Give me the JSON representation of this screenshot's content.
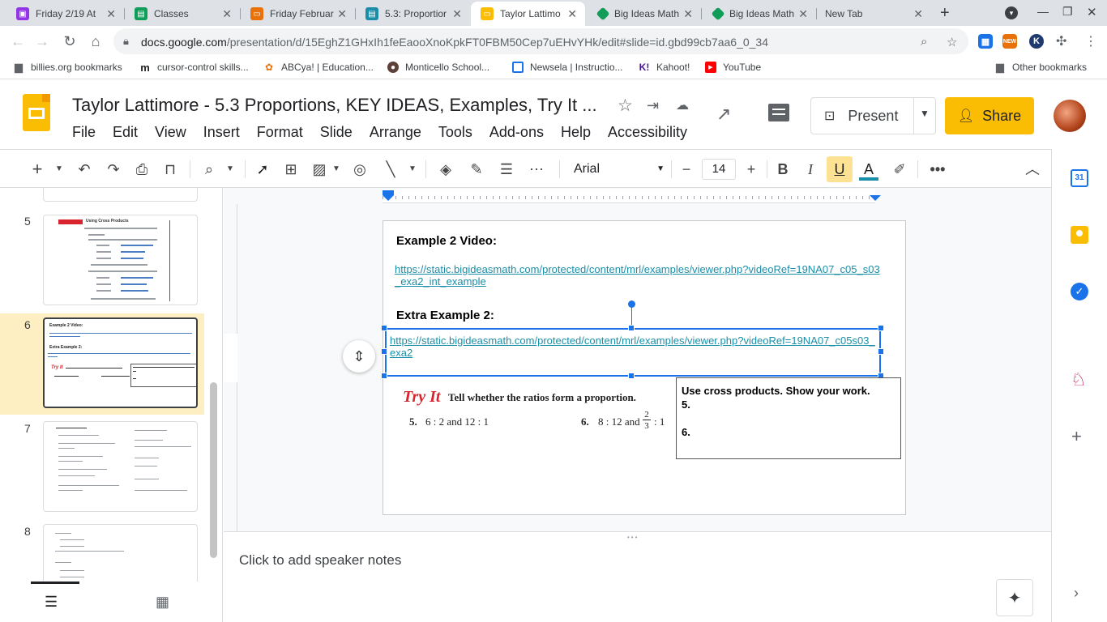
{
  "browser": {
    "tabs": [
      {
        "title": "Friday 2/19 At",
        "icon": "edu-icon",
        "color": "#9334e6",
        "active": false
      },
      {
        "title": "Classes",
        "icon": "classroom-icon",
        "color": "#0f9d58",
        "active": false
      },
      {
        "title": "Friday Februar",
        "icon": "slides-icon",
        "color": "#e8710a",
        "active": false
      },
      {
        "title": "5.3: Proportior",
        "icon": "classroom-icon",
        "color": "#1a8ea8",
        "active": false
      },
      {
        "title": "Taylor Lattimo",
        "icon": "slides-icon",
        "color": "#fbbc04",
        "active": true
      },
      {
        "title": "Big Ideas Math",
        "icon": "bigideas-icon",
        "color": "#0f9d58",
        "active": false
      },
      {
        "title": "Big Ideas Math",
        "icon": "bigideas-icon",
        "color": "#0f9d58",
        "active": false
      },
      {
        "title": "New Tab",
        "icon": "",
        "color": "",
        "active": false
      }
    ],
    "url_host": "docs.google.com",
    "url_path": "/presentation/d/15EghZ1GHxIh1feEaooXnoKpkFT0FBM50Cep7uEHvYHk/edit#slide=id.gbd99cb7aa6_0_34",
    "ext_new_label": "NEW",
    "bookmarks": [
      {
        "label": "billies.org bookmarks",
        "icon": "folder-icon"
      },
      {
        "label": "cursor-control skills...",
        "icon": "m-icon"
      },
      {
        "label": "ABCya! | Education...",
        "icon": "abcya-icon"
      },
      {
        "label": "Monticello School...",
        "icon": "school-icon"
      },
      {
        "label": "Newsela | Instructio...",
        "icon": "newsela-icon"
      },
      {
        "label": "Kahoot!",
        "icon": "kahoot-icon"
      },
      {
        "label": "YouTube",
        "icon": "youtube-icon"
      }
    ],
    "other_bookmarks": "Other bookmarks"
  },
  "app": {
    "doc_title": "Taylor Lattimore - 5.3 Proportions, KEY IDEAS,  Examples, Try It ...",
    "menus": [
      "File",
      "Edit",
      "View",
      "Insert",
      "Format",
      "Slide",
      "Arrange",
      "Tools",
      "Add-ons",
      "Help",
      "Accessibility"
    ],
    "present_label": "Present",
    "share_label": "Share",
    "brand_color": "#fbbc04"
  },
  "toolbar": {
    "font": "Arial",
    "font_size": "14"
  },
  "filmstrip": {
    "slides": [
      {
        "num": "5",
        "selected": false
      },
      {
        "num": "6",
        "selected": true
      },
      {
        "num": "7",
        "selected": false
      },
      {
        "num": "8",
        "selected": false
      }
    ],
    "thumb5_title": "Using Cross Products",
    "thumb6_title": "Example 2 Video:",
    "thumb6_extra": "Extra Example 2:"
  },
  "slide": {
    "heading1": "Example 2 Video:",
    "link1": "https://static.bigideasmath.com/protected/content/mrl/examples/viewer.php?videoRef=19NA07_c05_s03_exa2_int_example",
    "heading2": "Extra Example 2:",
    "link2": "https://static.bigideasmath.com/protected/content/mrl/examples/viewer.php?videoRef=19NA07_c05s03_exa2",
    "tryit_label": "Try It",
    "tryit_prompt": "Tell whether the ratios form a proportion.",
    "problem5_num": "5.",
    "problem5": "6 : 2 and 12 : 1",
    "problem6_num": "6.",
    "problem6_prefix": "8 : 12 and",
    "problem6_num_frac": "2",
    "problem6_den_frac": "3",
    "problem6_suffix": ": 1",
    "work_title": "Use cross products.  Show your work.",
    "work_5": "5.",
    "work_6": "6."
  },
  "notes": {
    "placeholder": "Click to add speaker notes"
  }
}
